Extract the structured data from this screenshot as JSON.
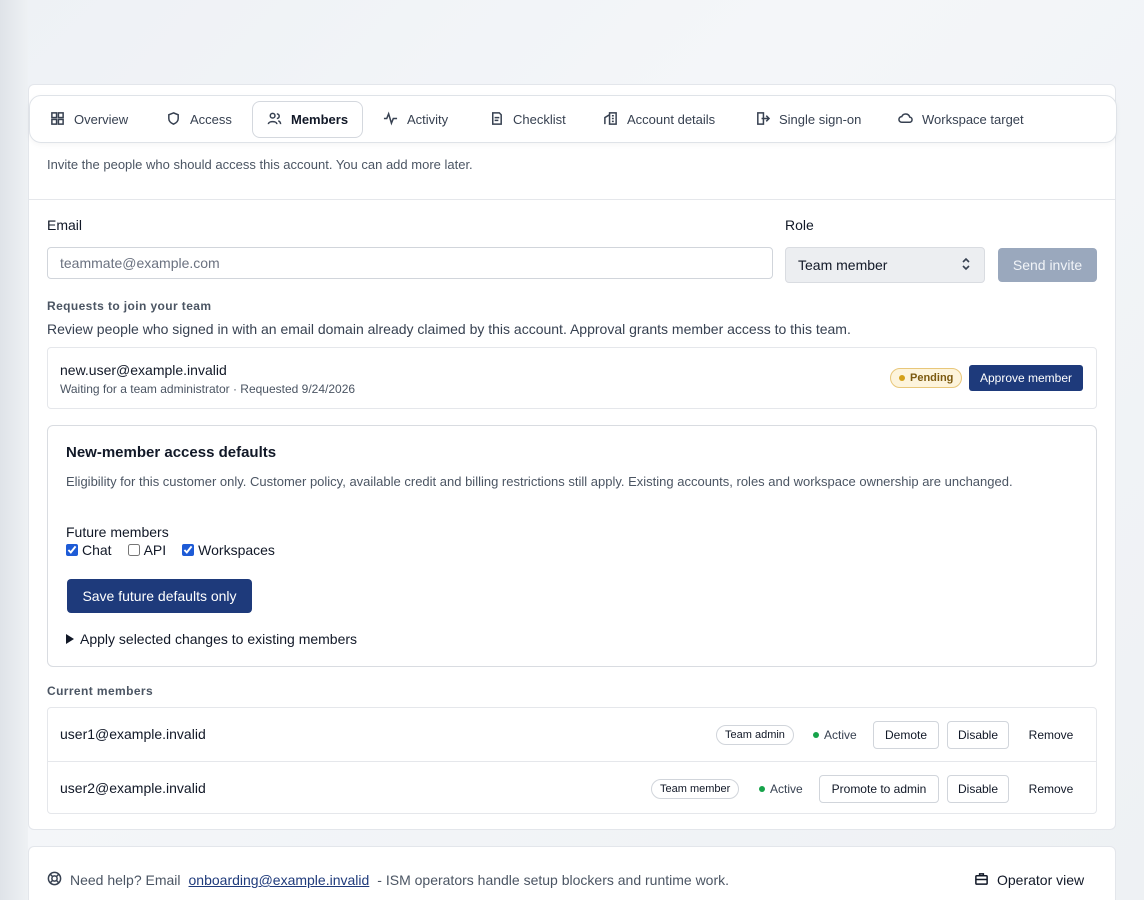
{
  "tabs": [
    {
      "label": "Overview",
      "icon": "grid-icon"
    },
    {
      "label": "Access",
      "icon": "shield-icon"
    },
    {
      "label": "Members",
      "icon": "users-icon",
      "active": true
    },
    {
      "label": "Activity",
      "icon": "activity-icon"
    },
    {
      "label": "Checklist",
      "icon": "checklist-icon"
    },
    {
      "label": "Account details",
      "icon": "building-icon"
    },
    {
      "label": "Single sign-on",
      "icon": "sign-in-icon"
    },
    {
      "label": "Workspace target",
      "icon": "cloud-icon"
    }
  ],
  "intro": "Invite the people who should access this account. You can add more later.",
  "invite": {
    "email_label": "Email",
    "email_placeholder": "teammate@example.com",
    "role_label": "Role",
    "role_value": "Team member",
    "send_label": "Send invite"
  },
  "requests": {
    "heading": "Requests to join your team",
    "description": "Review people who signed in with an email domain already claimed by this account. Approval grants member access to this team.",
    "items": [
      {
        "email": "new.user@example.invalid",
        "meta": "Waiting for a team administrator · Requested 9/24/2026",
        "badge": "Pending",
        "action": "Approve member"
      }
    ]
  },
  "defaults": {
    "title": "New-member access defaults",
    "description": "Eligibility for this customer only. Customer policy, available credit and billing restrictions still apply. Existing accounts, roles and workspace ownership are unchanged.",
    "future_label": "Future members",
    "options": [
      {
        "label": "Chat",
        "checked": true
      },
      {
        "label": "API",
        "checked": false
      },
      {
        "label": "Workspaces",
        "checked": true
      }
    ],
    "save_label": "Save future defaults only",
    "apply_label": "Apply selected changes to existing members"
  },
  "members": {
    "heading": "Current members",
    "rows": [
      {
        "email": "user1@example.invalid",
        "role": "Team admin",
        "status": "Active",
        "primary_action": "Demote",
        "disable": "Disable",
        "remove": "Remove"
      },
      {
        "email": "user2@example.invalid",
        "role": "Team member",
        "status": "Active",
        "primary_action": "Promote to admin",
        "disable": "Disable",
        "remove": "Remove"
      }
    ]
  },
  "help": {
    "prefix": "Need help? Email",
    "email": "onboarding@example.invalid",
    "suffix": "- ISM operators handle setup blockers and runtime work.",
    "operator_label": "Operator view"
  },
  "colors": {
    "primary": "#1e3a7b",
    "disabled_button": "#9aa8bd",
    "active_status": "#16a34a",
    "pending_status": "#d4a11a"
  }
}
